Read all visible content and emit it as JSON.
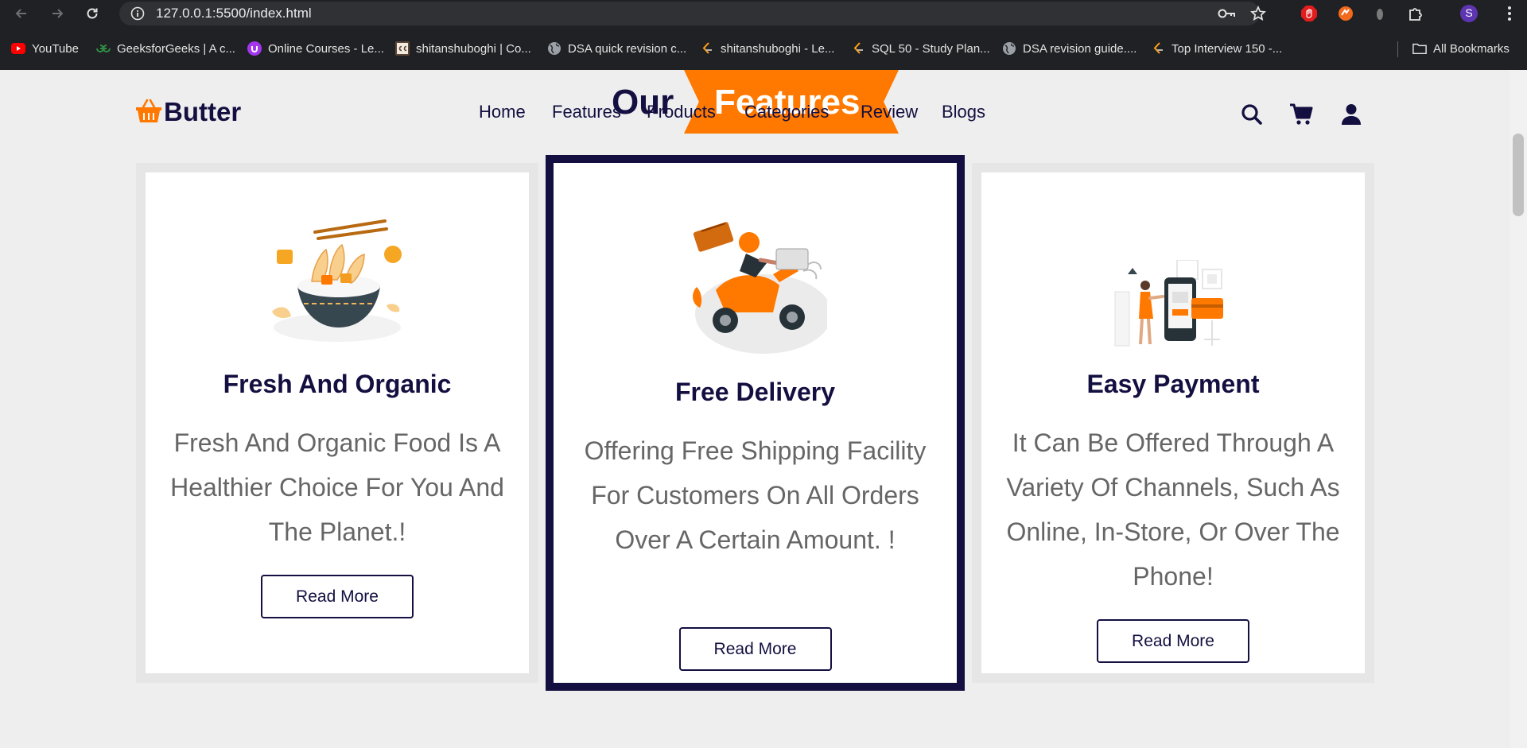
{
  "browser": {
    "url": "127.0.0.1:5500/index.html",
    "profile_initial": "S",
    "bookmarks": [
      {
        "label": "YouTube",
        "icon": "youtube-icon"
      },
      {
        "label": "GeeksforGeeks | A c...",
        "icon": "gfg-icon"
      },
      {
        "label": "Online Courses - Le...",
        "icon": "udemy-icon"
      },
      {
        "label": "shitanshuboghi | Co...",
        "icon": "codechef-icon"
      },
      {
        "label": "DSA quick revision c...",
        "icon": "globe-icon"
      },
      {
        "label": "shitanshuboghi - Le...",
        "icon": "leetcode-icon"
      },
      {
        "label": "SQL 50 - Study Plan...",
        "icon": "leetcode-icon"
      },
      {
        "label": "DSA revision guide....",
        "icon": "globe-icon"
      },
      {
        "label": "Top Interview 150 -...",
        "icon": "leetcode-icon"
      }
    ],
    "all_bookmarks_label": "All Bookmarks"
  },
  "header": {
    "logo_text": "Butter",
    "nav": [
      "Home",
      "Features",
      "Products",
      "Categories",
      "Review",
      "Blogs"
    ]
  },
  "section": {
    "heading_part1": "Our",
    "heading_part2": "Features"
  },
  "features": [
    {
      "title": "Fresh And Organic",
      "text": "Fresh And Organic Food Is A Healthier Choice For You And The Planet.!",
      "button": "Read More",
      "image": "food-bowl-illustration"
    },
    {
      "title": "Free Delivery",
      "text": "Offering Free Shipping Facility For Customers On All Orders Over A Certain Amount. !",
      "button": "Read More",
      "image": "delivery-scooter-illustration"
    },
    {
      "title": "Easy Payment",
      "text": "It Can Be Offered Through A Variety Of Channels, Such As Online, In-Store, Or Over The Phone!",
      "button": "Read More",
      "image": "mobile-payment-illustration"
    }
  ],
  "colors": {
    "accent": "#ff7800",
    "dark": "#130f40",
    "text_gray": "#666666",
    "page_bg": "#eeeeee"
  }
}
